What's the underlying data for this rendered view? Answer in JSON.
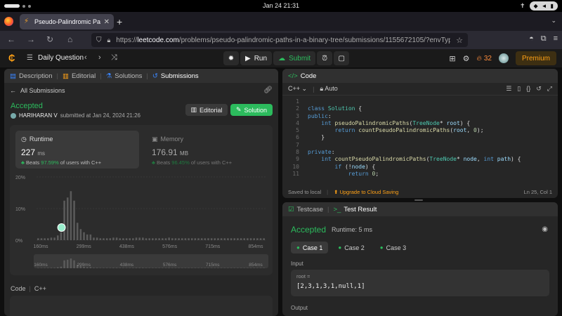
{
  "os": {
    "clock": "Jan 24  21:31"
  },
  "browser": {
    "tab_title": "Pseudo-Palindromic Paths",
    "url_prefix": "https://",
    "url_host": "leetcode.com",
    "url_path": "/problems/pseudo-palindromic-paths-in-a-binary-tree/submissions/1155672105/?envType=daily"
  },
  "header": {
    "daily_question": "Daily Question",
    "run": "Run",
    "submit": "Submit",
    "streak": "32",
    "premium": "Premium"
  },
  "left": {
    "tabs": [
      "Description",
      "Editorial",
      "Solutions",
      "Submissions"
    ],
    "all_submissions": "All Submissions",
    "status": "Accepted",
    "user": "HARIHARAN V",
    "submitted_text": "submitted at Jan 24, 2024 21:26",
    "editorial_btn": "Editorial",
    "solution_btn": "Solution",
    "runtime": {
      "label": "Runtime",
      "value": "227",
      "unit": "ms",
      "beats_prefix": "Beats",
      "beats_pct": "97.59%",
      "beats_suffix": "of users with C++"
    },
    "memory": {
      "label": "Memory",
      "value": "176.91",
      "unit": "MB",
      "beats_prefix": "Beats",
      "beats_pct": "96.45%",
      "beats_suffix": "of users with C++"
    },
    "code_label": "Code",
    "code_lang": "C++"
  },
  "chart_data": {
    "type": "bar",
    "title": "",
    "xlabel": "",
    "ylabel": "",
    "y_ticks": [
      "0%",
      "10%",
      "20%"
    ],
    "ylim": [
      0,
      20
    ],
    "x_ticks": [
      "160ms",
      "299ms",
      "438ms",
      "576ms",
      "715ms",
      "854ms"
    ],
    "values": [
      0.6,
      0.6,
      0.6,
      0.6,
      0.8,
      0.8,
      1.5,
      2.5,
      12.5,
      13.5,
      15.5,
      12.5,
      5.5,
      3.5,
      2.5,
      1.8,
      1.8,
      0.8,
      0.8,
      0.6,
      0.6,
      0.6,
      0.6,
      0.8,
      0.8,
      0.6,
      0.6,
      0.6,
      0.6,
      0.6,
      0.8,
      0.8,
      0.8,
      0.6,
      0.6,
      0.6,
      0.6,
      0.6,
      0.6,
      0.6,
      0.8,
      0.6,
      0.6,
      0.6,
      0.6,
      0.6,
      0.6,
      0.6,
      0.6,
      0.6,
      0.6,
      0.6,
      0.6,
      0.6,
      0.6,
      0.6,
      0.6,
      0.6,
      0.6,
      0.6,
      0.6,
      0.6,
      0.6,
      0.6,
      0.6,
      0.6,
      0.6,
      0.6,
      0.6,
      0.6
    ],
    "highlight_index": 8,
    "grid": true,
    "legend": "none"
  },
  "right_top": {
    "title": "Code",
    "lang": "C++",
    "mode": "Auto",
    "lines": [
      {
        "n": "1",
        "html": ""
      },
      {
        "n": "2",
        "html": "<span class='kw'>class</span> <span class='ty'>Solution</span> {"
      },
      {
        "n": "3",
        "html": "<span class='kw'>public</span>:"
      },
      {
        "n": "4",
        "html": "    <span class='kw'>int</span> <span class='fn'>pseudoPalindromicPaths</span>(<span class='ty'>TreeNode</span>* <span class='pr'>root</span>) {"
      },
      {
        "n": "5",
        "html": "        <span class='kw'>return</span> <span class='fn'>countPseudoPalindromicPaths</span>(<span class='pr'>root</span>, <span class='nm'>0</span>);"
      },
      {
        "n": "6",
        "html": "    }"
      },
      {
        "n": "7",
        "html": ""
      },
      {
        "n": "8",
        "html": "<span class='kw'>private</span>:"
      },
      {
        "n": "9",
        "html": "    <span class='kw'>int</span> <span class='fn'>countPseudoPalindromicPaths</span>(<span class='ty'>TreeNode</span>* <span class='pr'>node</span>, <span class='kw'>int</span> <span class='pr'>path</span>) {"
      },
      {
        "n": "10",
        "html": "        <span class='kw'>if</span> (!<span class='pr'>node</span>) {"
      },
      {
        "n": "11",
        "html": "            <span class='kw'>return</span> <span class='nm'>0</span>;"
      }
    ],
    "saved": "Saved to local",
    "upgrade": "Upgrade to Cloud Saving",
    "position": "Ln 25, Col 1"
  },
  "right_bottom": {
    "testcase_tab": "Testcase",
    "result_tab": "Test Result",
    "status": "Accepted",
    "runtime": "Runtime: 5 ms",
    "cases": [
      "Case 1",
      "Case 2",
      "Case 3"
    ],
    "input_label": "Input",
    "input_var": "root =",
    "input_value": "[2,3,1,3,1,null,1]",
    "output_label": "Output"
  }
}
